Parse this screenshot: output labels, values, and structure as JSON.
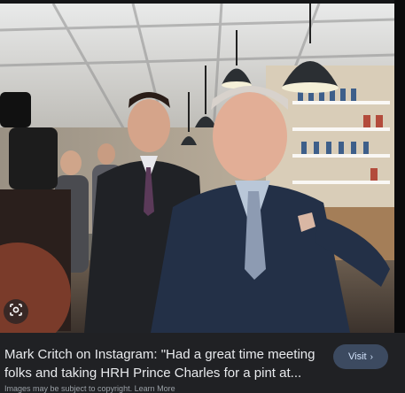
{
  "result": {
    "title": "Mark Critch on Instagram: \"Had a great time meeting folks and taking HRH Prince Charles for a pint at...",
    "visit_label": "Visit",
    "visit_icon": "chevron-right-icon",
    "copyright_notice": "Images may be subject to copyright.",
    "learn_more_label": "Learn More",
    "lens_icon": "lens-search-icon"
  },
  "colors": {
    "background": "#202124",
    "title_text": "#e8eaed",
    "visit_button_bg": "#3c4a60",
    "visit_button_text": "#d2e3fc"
  }
}
